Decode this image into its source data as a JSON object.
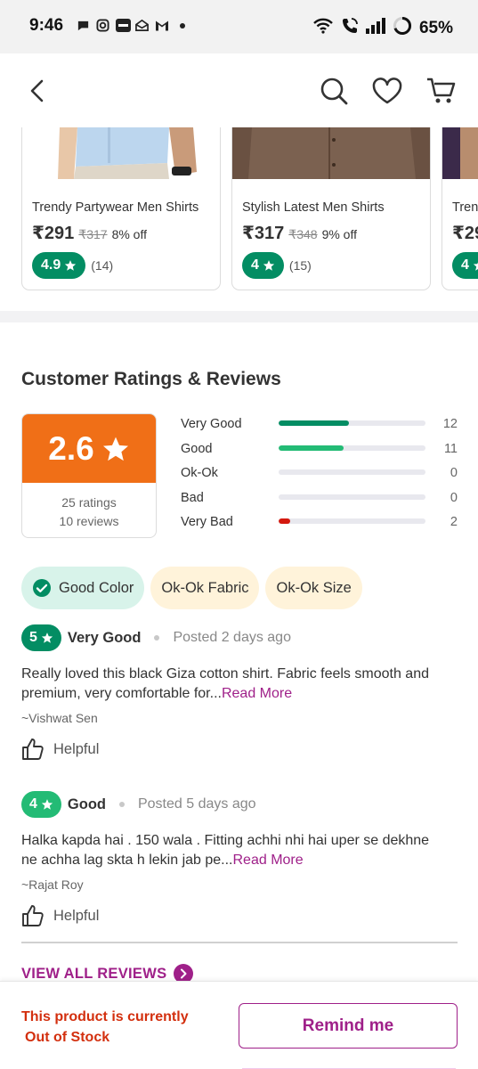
{
  "status_bar": {
    "time": "9:46",
    "notification_icons": [
      "chat-bubble-icon",
      "instagram-icon",
      "paytm-icon",
      "mail-open-icon",
      "gmail-icon",
      "dot-icon"
    ],
    "battery_percent": "65%"
  },
  "header": {
    "back_icon": "back-arrow-icon",
    "search_icon": "search-icon",
    "wishlist_icon": "heart-icon",
    "cart_icon": "cart-icon"
  },
  "similar_products": [
    {
      "name": "Trendy Partywear Men Shirts",
      "price": "₹291",
      "mrp": "₹317",
      "discount": "8% off",
      "rating": "4.9",
      "rating_count": "(14)"
    },
    {
      "name": "Stylish Latest Men Shirts",
      "price": "₹317",
      "mrp": "₹348",
      "discount": "9% off",
      "rating": "4",
      "rating_count": "(15)"
    },
    {
      "name": "Trendy Partywear Men Shirts",
      "price": "₹29",
      "rating": "4"
    }
  ],
  "ratings": {
    "title": "Customer Ratings & Reviews",
    "average": "2.6",
    "ratings_count": "25 ratings",
    "reviews_count": "10 reviews",
    "distribution": [
      {
        "label": "Very Good",
        "count": "12",
        "fraction": 0.48,
        "color": "#038d63"
      },
      {
        "label": "Good",
        "count": "11",
        "fraction": 0.44,
        "color": "#23bb75"
      },
      {
        "label": "Ok-Ok",
        "count": "0",
        "fraction": 0,
        "color": "#f5a623"
      },
      {
        "label": "Bad",
        "count": "0",
        "fraction": 0,
        "color": "#f06f17"
      },
      {
        "label": "Very Bad",
        "count": "2",
        "fraction": 0.08,
        "color": "#d4190f"
      }
    ]
  },
  "tags": [
    {
      "label": "Good Color",
      "icon": "check-circle-icon",
      "style": "good"
    },
    {
      "label": "Ok-Ok Fabric",
      "style": "okok"
    },
    {
      "label": "Ok-Ok Size",
      "style": "okok"
    }
  ],
  "reviews": [
    {
      "rating": "5",
      "rating_color": "#038d63",
      "title": "Very Good",
      "posted": "Posted 2 days ago",
      "text": "Really loved this black Giza cotton shirt. Fabric feels smooth and premium, very comfortable for...",
      "read_more": "Read More",
      "author": "~Vishwat Sen",
      "helpful": "Helpful"
    },
    {
      "rating": "4",
      "rating_color": "#23bb75",
      "title": "Good",
      "posted": "Posted 5 days ago",
      "text": "Halka kapda hai . 150 wala . Fitting achhi nhi hai uper se dekhne ne achha lag skta h lekin jab pe...",
      "read_more": "Read More",
      "author": "~Rajat Roy",
      "helpful": "Helpful"
    }
  ],
  "view_all_reviews": "VIEW ALL REVIEWS",
  "bottom_bar": {
    "stock_line1": "This product is currently",
    "stock_line2": "Out of Stock",
    "remind_label": "Remind me"
  },
  "colors": {
    "brand": "#9f2089",
    "rating_green": "#038d63",
    "average_orange": "#f06f17",
    "out_of_stock_red": "#d32f0e"
  }
}
